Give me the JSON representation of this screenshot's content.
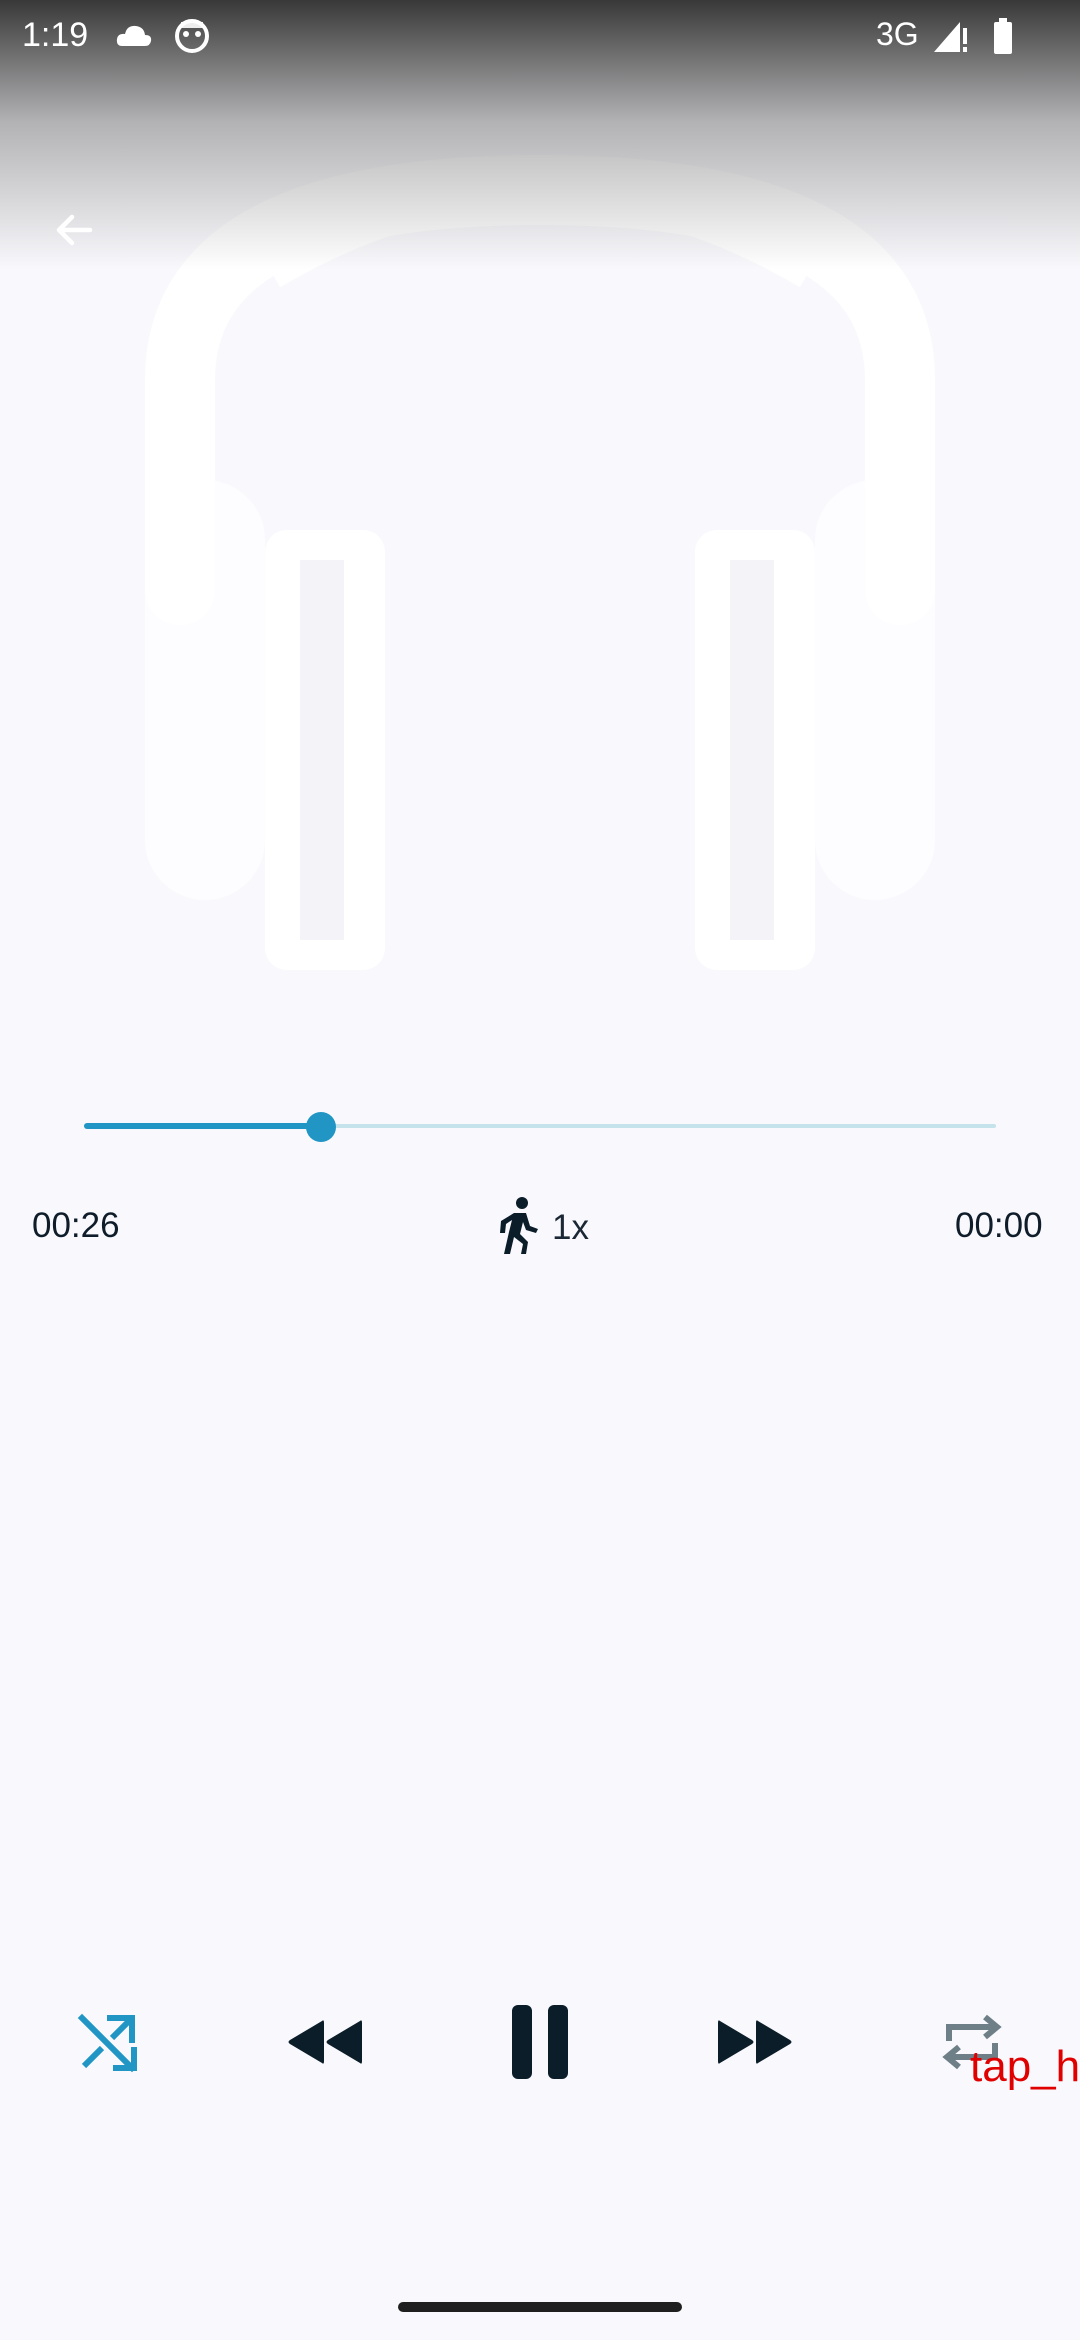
{
  "status_bar": {
    "time": "1:19",
    "network": "3G",
    "icons": [
      "cloud-icon",
      "android-icon",
      "signal-icon",
      "battery-icon"
    ]
  },
  "header": {
    "back_icon": "arrow-back-icon"
  },
  "player": {
    "artwork_icon": "headphones-icon",
    "progress_fraction": 0.26,
    "elapsed": "00:26",
    "remaining": "00:00",
    "speed_label": "1x",
    "speed_icon": "running-man-icon"
  },
  "controls": {
    "shuffle_icon": "shuffle-icon",
    "rewind_icon": "rewind-icon",
    "pause_icon": "pause-icon",
    "fast_forward_icon": "fast-forward-icon",
    "repeat_icon": "repeat-icon"
  },
  "overlay": {
    "text": "tap_h"
  },
  "colors": {
    "accent": "#2196c4",
    "track": "#c5e3ea",
    "background": "#f9f9fd",
    "control_dark": "#0b1d29",
    "repeat_gray": "#6e7f88",
    "overlay_red": "#e00000"
  }
}
